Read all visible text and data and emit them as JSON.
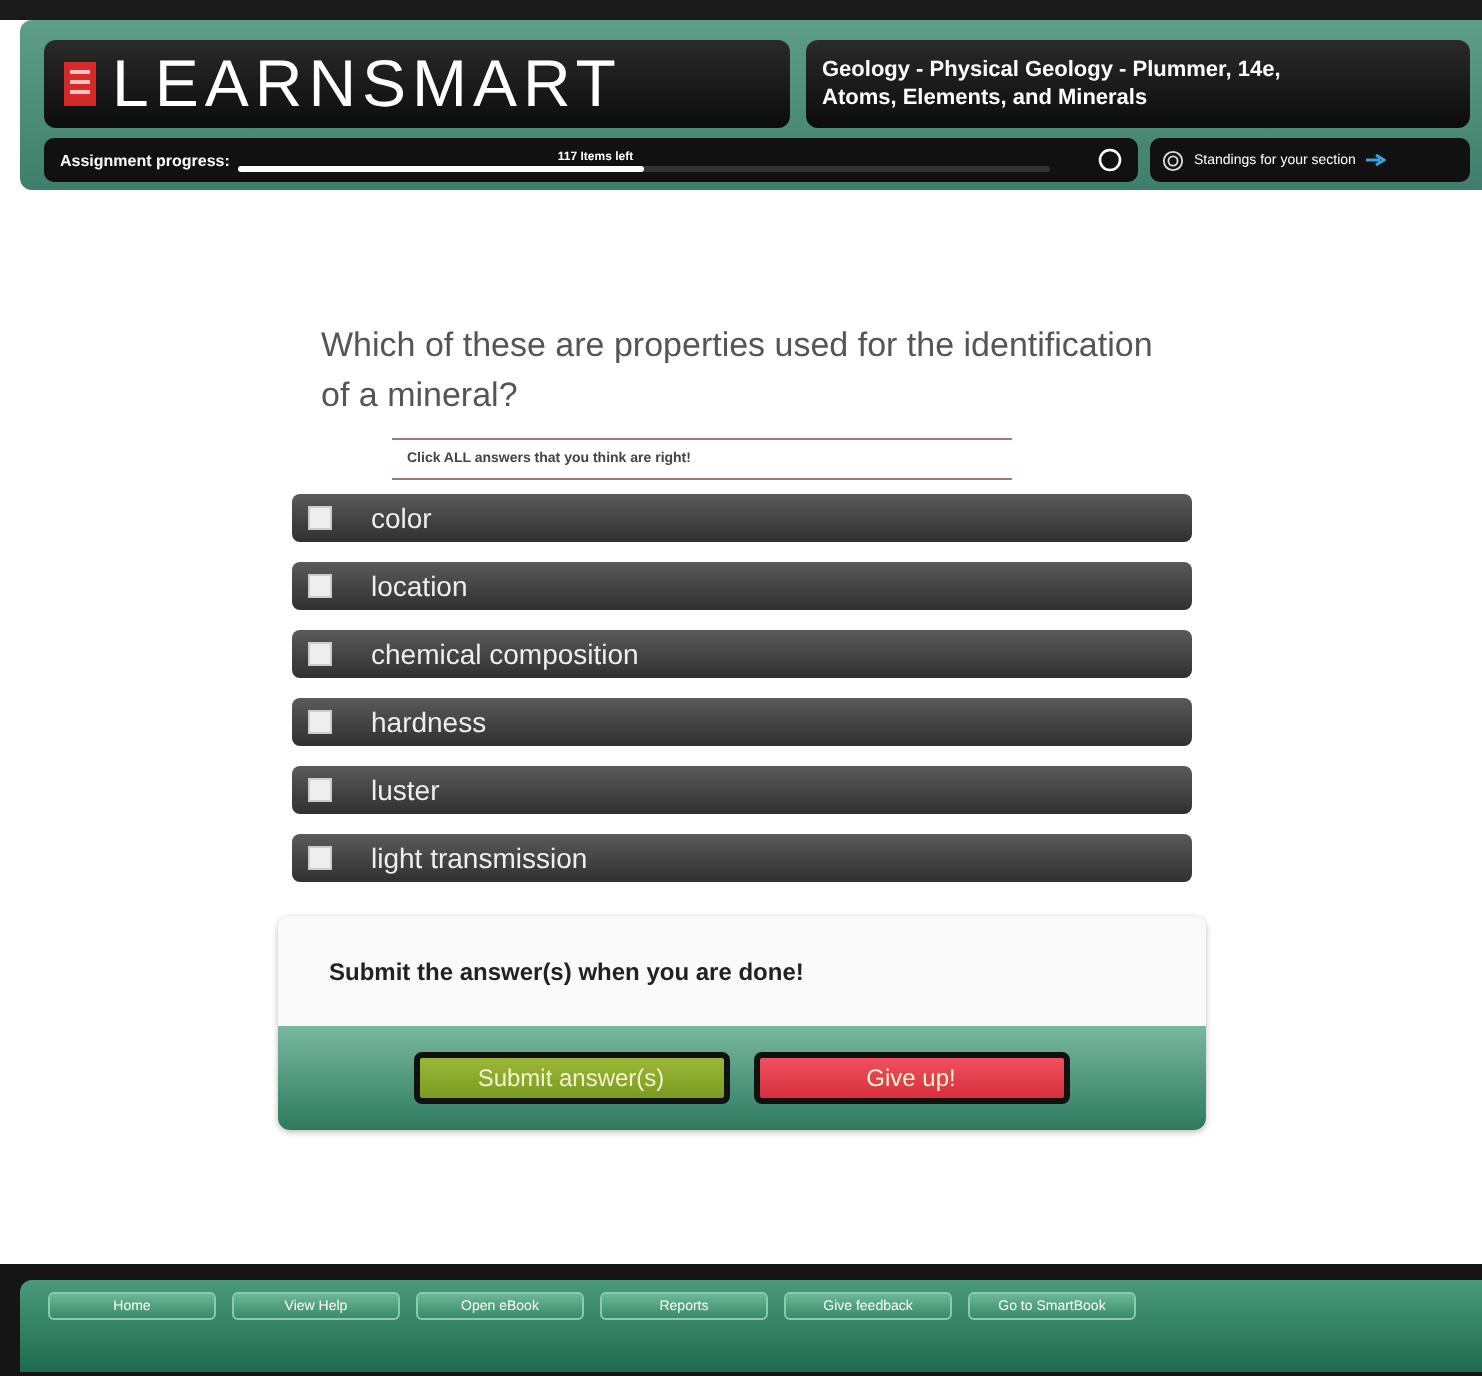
{
  "header": {
    "logo": "LEARNSMART",
    "course_title": "Geology - Physical Geology - Plummer, 14e,",
    "topic": "Atoms, Elements, and Minerals"
  },
  "progress": {
    "label": "Assignment progress:",
    "items_left": "117 Items left",
    "level": 0.5,
    "standings": "Standings for your section"
  },
  "question": {
    "text": "Which of these are properties used for the identification of a mineral?",
    "instruction": "Click ALL answers that you think are right!"
  },
  "options": [
    {
      "label": "color",
      "checked": false
    },
    {
      "label": "location",
      "checked": false
    },
    {
      "label": "chemical composition",
      "checked": false
    },
    {
      "label": "hardness",
      "checked": false
    },
    {
      "label": "luster",
      "checked": false
    },
    {
      "label": "light transmission",
      "checked": false
    }
  ],
  "submit_panel": {
    "message": "Submit the answer(s) when you are done!",
    "buttons": [
      {
        "label": "Submit answer(s)",
        "kind": "submit"
      },
      {
        "label": "Give up!",
        "kind": "giveup"
      }
    ]
  },
  "footer": {
    "buttons": [
      "Home",
      "View Help",
      "Open eBook",
      "Reports",
      "Give feedback",
      "Go to SmartBook"
    ]
  }
}
